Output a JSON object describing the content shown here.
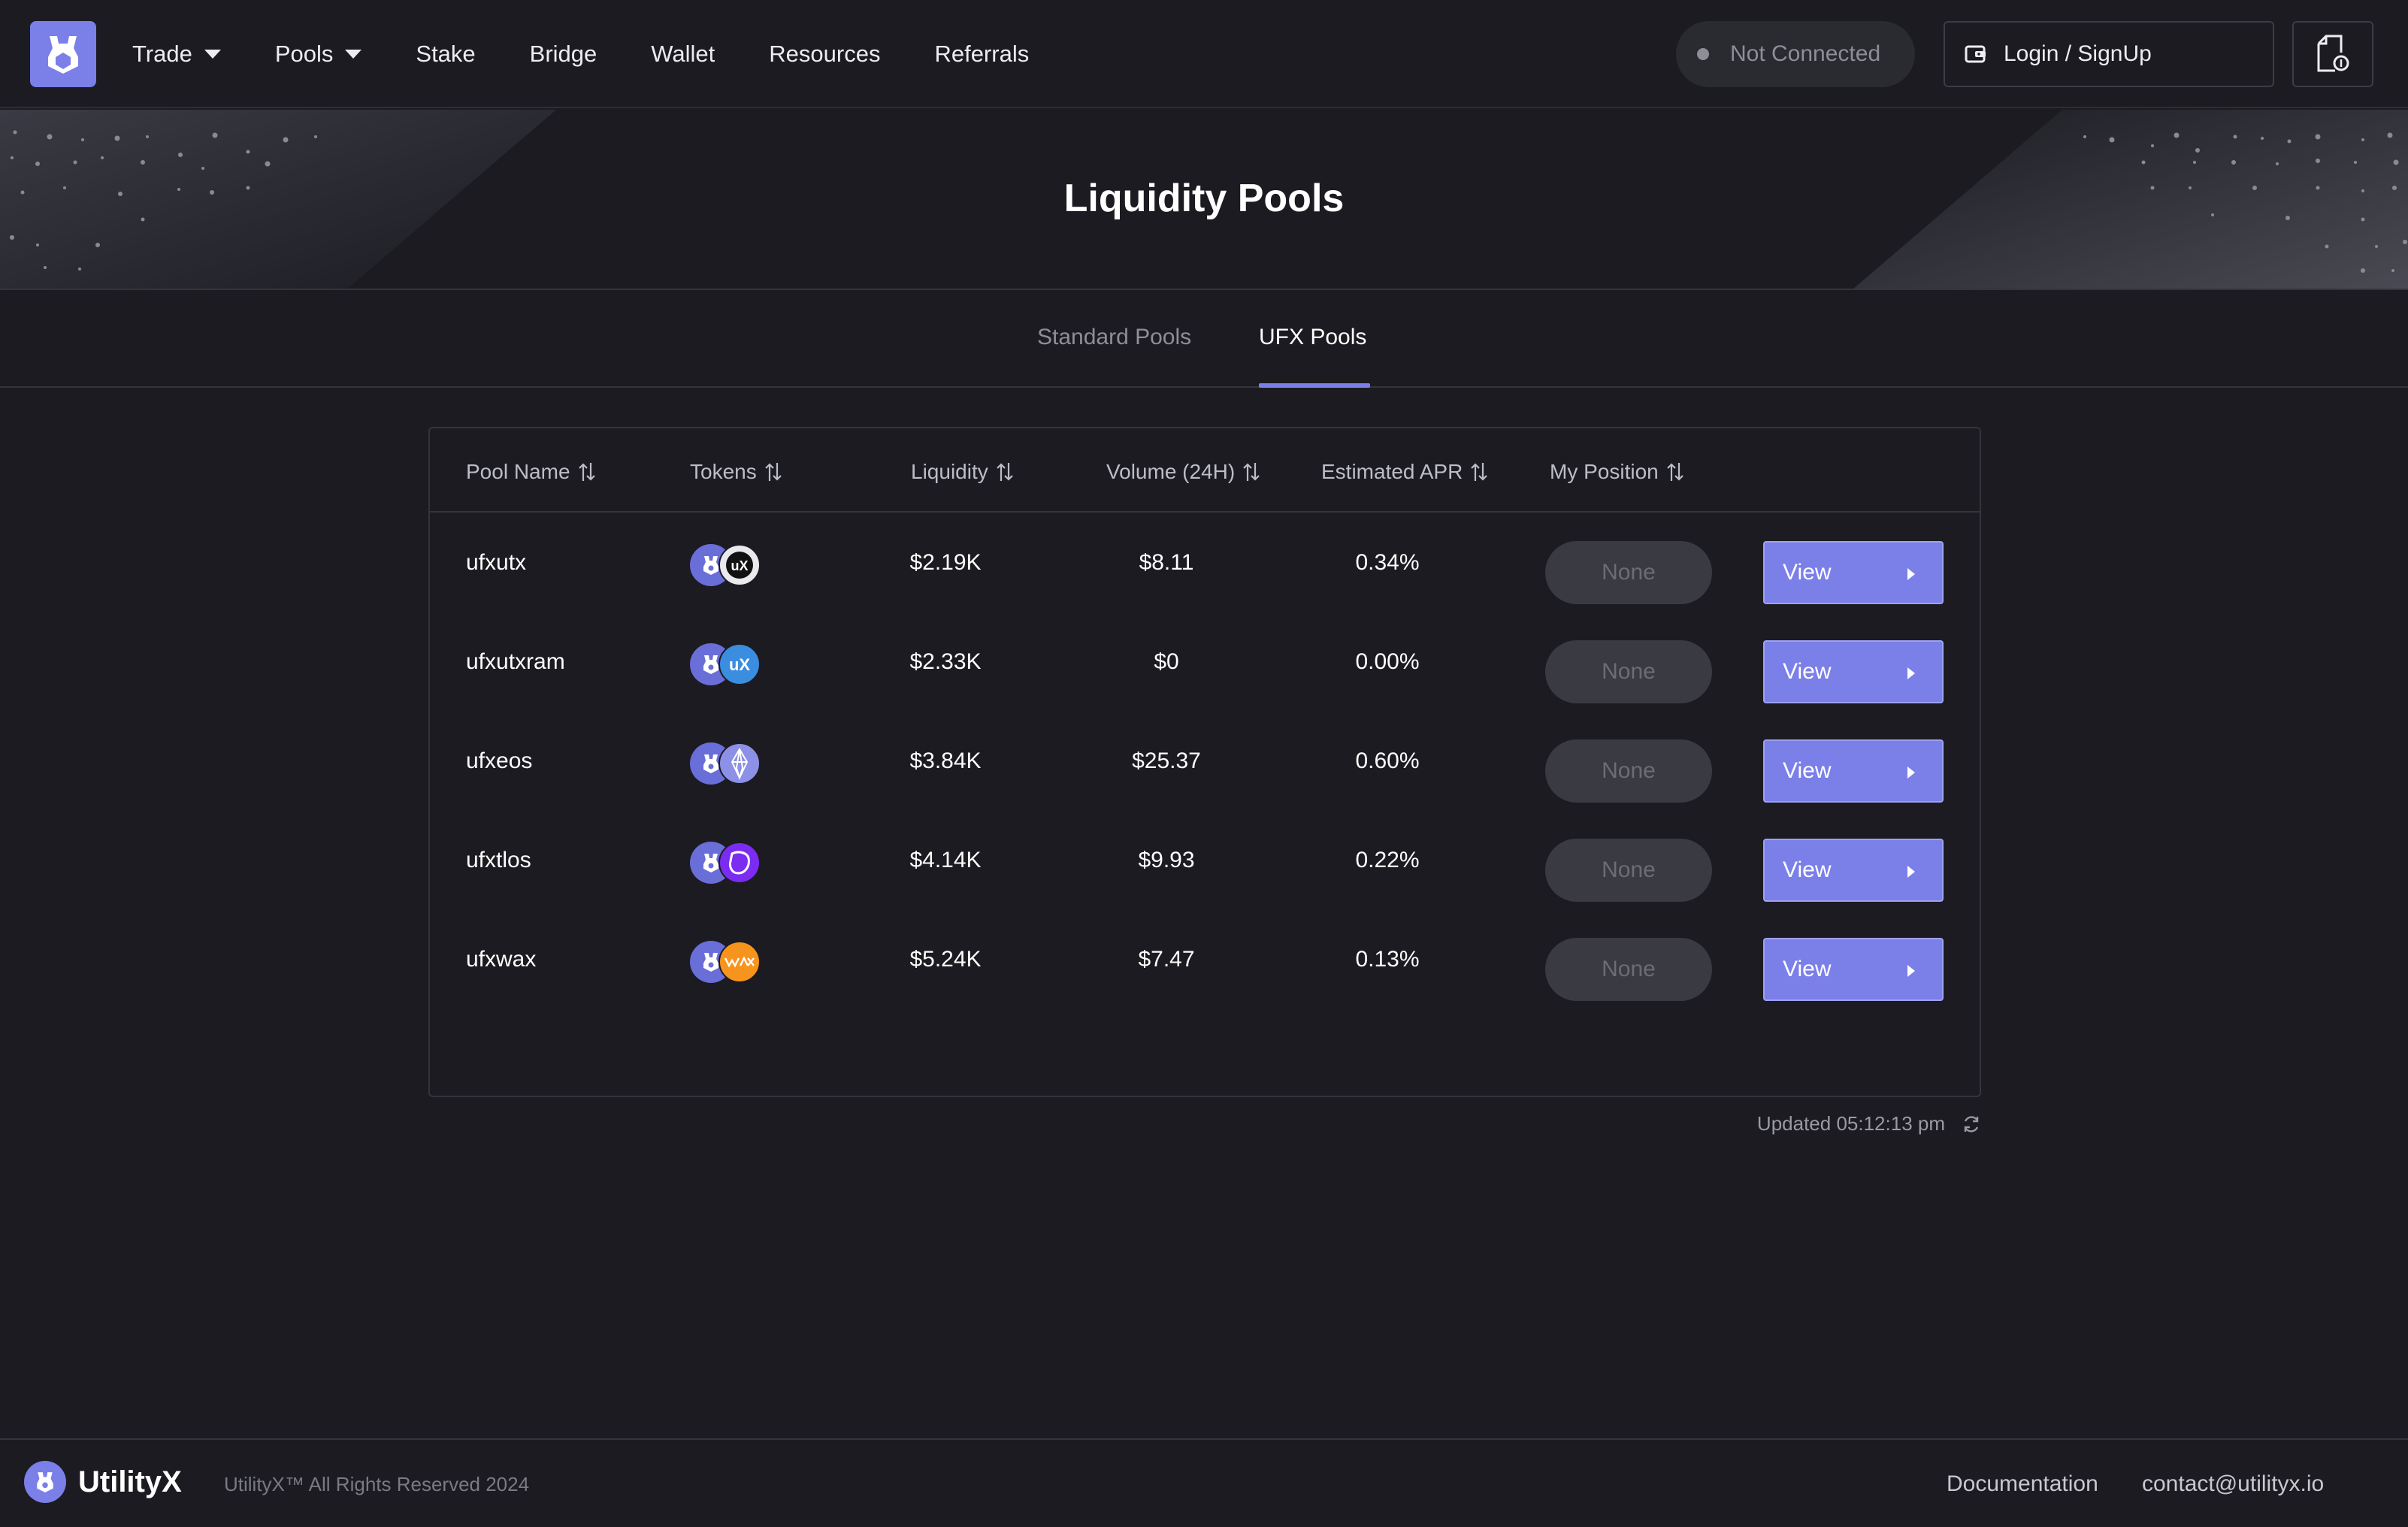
{
  "nav": {
    "items": [
      {
        "label": "Trade",
        "has_dropdown": true
      },
      {
        "label": "Pools",
        "has_dropdown": true
      },
      {
        "label": "Stake",
        "has_dropdown": false
      },
      {
        "label": "Bridge",
        "has_dropdown": false
      },
      {
        "label": "Wallet",
        "has_dropdown": false
      },
      {
        "label": "Resources",
        "has_dropdown": false
      },
      {
        "label": "Referrals",
        "has_dropdown": false
      }
    ],
    "connection_status": "Not Connected",
    "login_label": "Login / SignUp"
  },
  "hero": {
    "title": "Liquidity Pools"
  },
  "tabs": [
    {
      "label": "Standard Pools",
      "active": false
    },
    {
      "label": "UFX Pools",
      "active": true
    }
  ],
  "table": {
    "columns": [
      "Pool Name",
      "Tokens",
      "Liquidity",
      "Volume (24H)",
      "Estimated APR",
      "My Position"
    ],
    "rows": [
      {
        "name": "ufxutx",
        "token_b": "utx",
        "liquidity": "$2.19K",
        "volume": "$8.11",
        "apr": "0.34%",
        "position": "None",
        "action": "View"
      },
      {
        "name": "ufxutxram",
        "token_b": "utxram",
        "liquidity": "$2.33K",
        "volume": "$0",
        "apr": "0.00%",
        "position": "None",
        "action": "View"
      },
      {
        "name": "ufxeos",
        "token_b": "eos",
        "liquidity": "$3.84K",
        "volume": "$25.37",
        "apr": "0.60%",
        "position": "None",
        "action": "View"
      },
      {
        "name": "ufxtlos",
        "token_b": "tlos",
        "liquidity": "$4.14K",
        "volume": "$9.93",
        "apr": "0.22%",
        "position": "None",
        "action": "View"
      },
      {
        "name": "ufxwax",
        "token_b": "wax",
        "liquidity": "$5.24K",
        "volume": "$7.47",
        "apr": "0.13%",
        "position": "None",
        "action": "View"
      }
    ],
    "updated_text": "Updated 05:12:13 pm"
  },
  "footer": {
    "brand": "UtilityX",
    "copyright": "UtilityX™ All Rights Reserved 2024",
    "links": [
      "Documentation",
      "contact@utilityx.io"
    ]
  },
  "colors": {
    "background": "#1b1b21",
    "accent": "#7b7fe8",
    "border": "#34343c",
    "muted_text": "#8e8e98"
  }
}
